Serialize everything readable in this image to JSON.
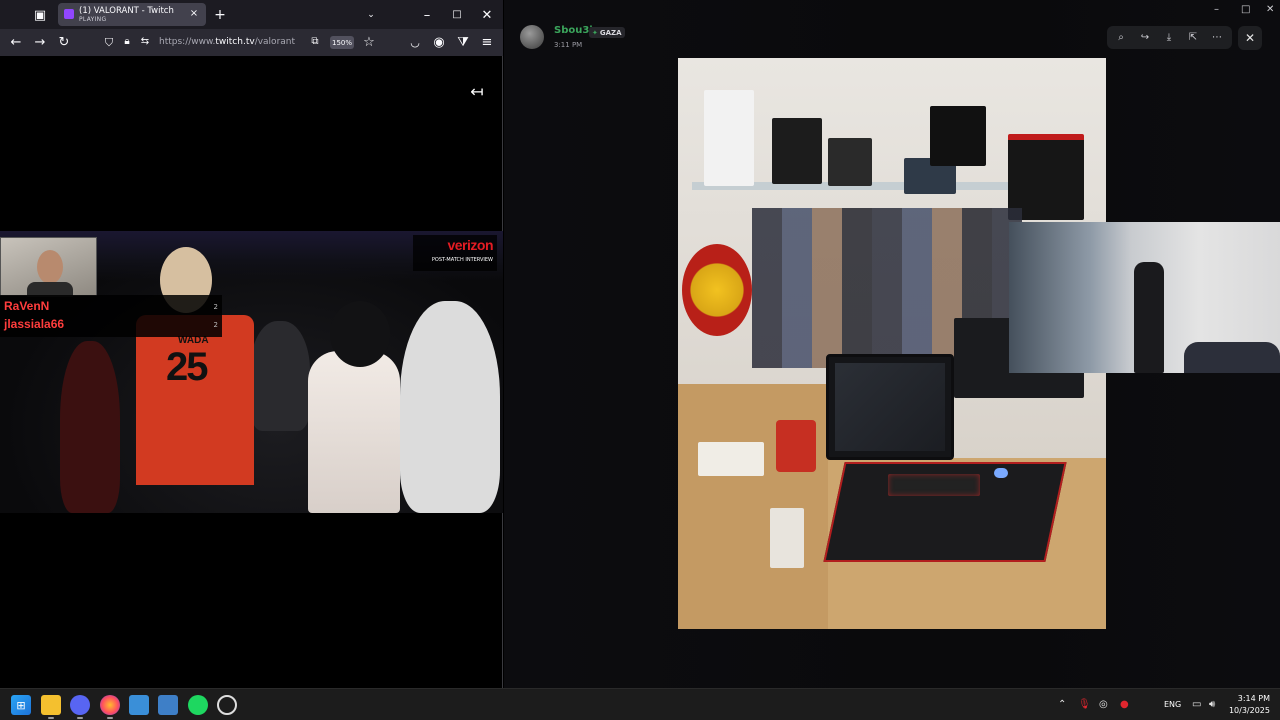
{
  "browser": {
    "tab_title": "(1) VALORANT - Twitch",
    "tab_status": "PLAYING",
    "url_prefix": "https://www.",
    "url_host": "twitch.tv",
    "url_path": "/valorant",
    "zoom": "150%"
  },
  "stream": {
    "sponsor": "verizon",
    "sponsor_sub": "POST-MATCH INTERVIEW",
    "chat": [
      {
        "name": "RaVenN",
        "count": "2"
      },
      {
        "name": "jlassiala66",
        "count": "2"
      }
    ],
    "jersey_name": "WADA",
    "jersey_number": "25"
  },
  "discord": {
    "username": "Sbou3i",
    "tag": "GAZA",
    "timestamp": "3:11 PM",
    "accent": "#3ba55c"
  },
  "taskbar": {
    "language": "ENG",
    "time": "3:14 PM",
    "date": "10/3/2025"
  }
}
